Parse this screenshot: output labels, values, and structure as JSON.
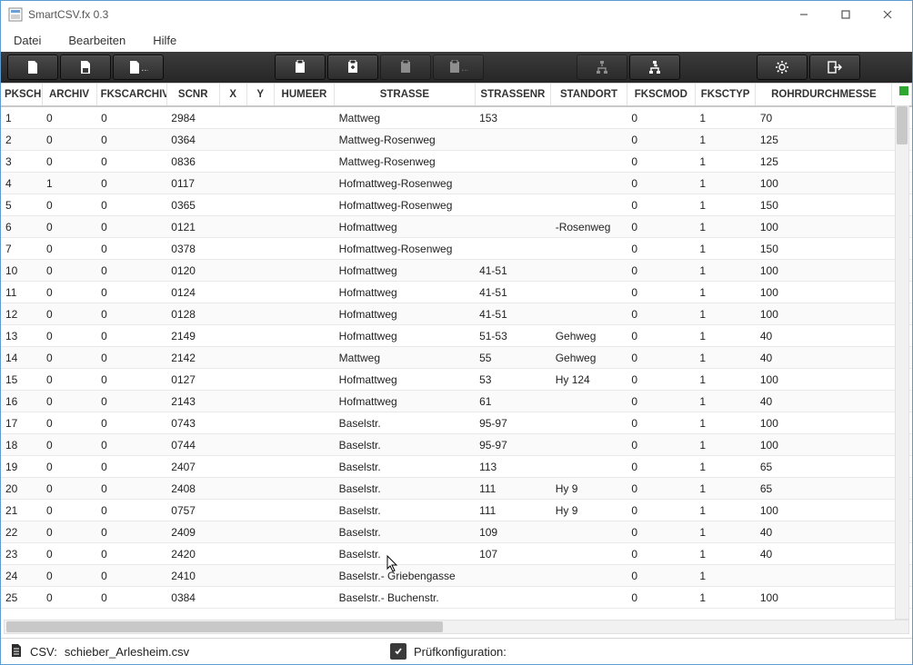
{
  "window": {
    "title": "SmartCSV.fx 0.3"
  },
  "menu": {
    "datei": "Datei",
    "bearbeiten": "Bearbeiten",
    "hilfe": "Hilfe"
  },
  "toolbar": {
    "new_doc": "new-document",
    "save_doc": "save-document",
    "more_doc": "document-menu",
    "clip1": "clipboard-copy",
    "clip2": "clipboard-paste",
    "clip3": "clipboard-col",
    "clip4": "clipboard-row",
    "diag1": "connect-node",
    "diag2": "expand-node",
    "settings": "settings",
    "exit": "exit"
  },
  "columns": [
    "PKSCHIEBER",
    "ARCHIV",
    "FKSCARCHIV",
    "SCNR",
    "X",
    "Y",
    "HUMEER",
    "STRASSE",
    "STRASSENR",
    "STANDORT",
    "FKSCMOD",
    "FKSCTYP",
    "ROHRDURCHMESSE"
  ],
  "rows": [
    {
      "id": "1",
      "archiv": "0",
      "fks": "0",
      "scnr": "2984",
      "x": "",
      "y": "",
      "hu": "",
      "str": "Mattweg",
      "strnr": "153",
      "stand": "",
      "mod": "0",
      "typ": "1",
      "rohr": "70"
    },
    {
      "id": "2",
      "archiv": "0",
      "fks": "0",
      "scnr": "0364",
      "x": "",
      "y": "",
      "hu": "",
      "str": "Mattweg-Rosenweg",
      "strnr": "",
      "stand": "",
      "mod": "0",
      "typ": "1",
      "rohr": "125"
    },
    {
      "id": "3",
      "archiv": "0",
      "fks": "0",
      "scnr": "0836",
      "x": "",
      "y": "",
      "hu": "",
      "str": "Mattweg-Rosenweg",
      "strnr": "",
      "stand": "",
      "mod": "0",
      "typ": "1",
      "rohr": "125"
    },
    {
      "id": "4",
      "archiv": "1",
      "fks": "0",
      "scnr": "0117",
      "x": "",
      "y": "",
      "hu": "",
      "str": "Hofmattweg-Rosenweg",
      "strnr": "",
      "stand": "",
      "mod": "0",
      "typ": "1",
      "rohr": "100"
    },
    {
      "id": "5",
      "archiv": "0",
      "fks": "0",
      "scnr": "0365",
      "x": "",
      "y": "",
      "hu": "",
      "str": "Hofmattweg-Rosenweg",
      "strnr": "",
      "stand": "",
      "mod": "0",
      "typ": "1",
      "rohr": "150"
    },
    {
      "id": "6",
      "archiv": "0",
      "fks": "0",
      "scnr": "0121",
      "x": "",
      "y": "",
      "hu": "",
      "str": "Hofmattweg",
      "strnr": "",
      "stand": "-Rosenweg",
      "mod": "0",
      "typ": "1",
      "rohr": "100"
    },
    {
      "id": "7",
      "archiv": "0",
      "fks": "0",
      "scnr": "0378",
      "x": "",
      "y": "",
      "hu": "",
      "str": "Hofmattweg-Rosenweg",
      "strnr": "",
      "stand": "",
      "mod": "0",
      "typ": "1",
      "rohr": "150"
    },
    {
      "id": "10",
      "archiv": "0",
      "fks": "0",
      "scnr": "0120",
      "x": "",
      "y": "",
      "hu": "",
      "str": "Hofmattweg",
      "strnr": "41-51",
      "stand": "",
      "mod": "0",
      "typ": "1",
      "rohr": "100"
    },
    {
      "id": "11",
      "archiv": "0",
      "fks": "0",
      "scnr": "0124",
      "x": "",
      "y": "",
      "hu": "",
      "str": "Hofmattweg",
      "strnr": "41-51",
      "stand": "",
      "mod": "0",
      "typ": "1",
      "rohr": "100"
    },
    {
      "id": "12",
      "archiv": "0",
      "fks": "0",
      "scnr": "0128",
      "x": "",
      "y": "",
      "hu": "",
      "str": "Hofmattweg",
      "strnr": "41-51",
      "stand": "",
      "mod": "0",
      "typ": "1",
      "rohr": "100"
    },
    {
      "id": "13",
      "archiv": "0",
      "fks": "0",
      "scnr": "2149",
      "x": "",
      "y": "",
      "hu": "",
      "str": "Hofmattweg",
      "strnr": "51-53",
      "stand": "Gehweg",
      "mod": "0",
      "typ": "1",
      "rohr": "40"
    },
    {
      "id": "14",
      "archiv": "0",
      "fks": "0",
      "scnr": "2142",
      "x": "",
      "y": "",
      "hu": "",
      "str": "Mattweg",
      "strnr": "55",
      "stand": "Gehweg",
      "mod": "0",
      "typ": "1",
      "rohr": "40"
    },
    {
      "id": "15",
      "archiv": "0",
      "fks": "0",
      "scnr": "0127",
      "x": "",
      "y": "",
      "hu": "",
      "str": "Hofmattweg",
      "strnr": "53",
      "stand": "Hy 124",
      "mod": "0",
      "typ": "1",
      "rohr": "100"
    },
    {
      "id": "16",
      "archiv": "0",
      "fks": "0",
      "scnr": "2143",
      "x": "",
      "y": "",
      "hu": "",
      "str": "Hofmattweg",
      "strnr": "61",
      "stand": "",
      "mod": "0",
      "typ": "1",
      "rohr": "40"
    },
    {
      "id": "17",
      "archiv": "0",
      "fks": "0",
      "scnr": "0743",
      "x": "",
      "y": "",
      "hu": "",
      "str": "Baselstr.",
      "strnr": "95-97",
      "stand": "",
      "mod": "0",
      "typ": "1",
      "rohr": "100"
    },
    {
      "id": "18",
      "archiv": "0",
      "fks": "0",
      "scnr": "0744",
      "x": "",
      "y": "",
      "hu": "",
      "str": "Baselstr.",
      "strnr": "95-97",
      "stand": "",
      "mod": "0",
      "typ": "1",
      "rohr": "100"
    },
    {
      "id": "19",
      "archiv": "0",
      "fks": "0",
      "scnr": "2407",
      "x": "",
      "y": "",
      "hu": "",
      "str": "Baselstr.",
      "strnr": "113",
      "stand": "",
      "mod": "0",
      "typ": "1",
      "rohr": "65"
    },
    {
      "id": "20",
      "archiv": "0",
      "fks": "0",
      "scnr": "2408",
      "x": "",
      "y": "",
      "hu": "",
      "str": "Baselstr.",
      "strnr": "111",
      "stand": "Hy 9",
      "mod": "0",
      "typ": "1",
      "rohr": "65"
    },
    {
      "id": "21",
      "archiv": "0",
      "fks": "0",
      "scnr": "0757",
      "x": "",
      "y": "",
      "hu": "",
      "str": "Baselstr.",
      "strnr": "111",
      "stand": "Hy 9",
      "mod": "0",
      "typ": "1",
      "rohr": "100"
    },
    {
      "id": "22",
      "archiv": "0",
      "fks": "0",
      "scnr": "2409",
      "x": "",
      "y": "",
      "hu": "",
      "str": "Baselstr.",
      "strnr": "109",
      "stand": "",
      "mod": "0",
      "typ": "1",
      "rohr": "40"
    },
    {
      "id": "23",
      "archiv": "0",
      "fks": "0",
      "scnr": "2420",
      "x": "",
      "y": "",
      "hu": "",
      "str": "Baselstr.",
      "strnr": "107",
      "stand": "",
      "mod": "0",
      "typ": "1",
      "rohr": "40"
    },
    {
      "id": "24",
      "archiv": "0",
      "fks": "0",
      "scnr": "2410",
      "x": "",
      "y": "",
      "hu": "",
      "str": "Baselstr.- Griebengasse",
      "strnr": "",
      "stand": "",
      "mod": "0",
      "typ": "1",
      "rohr": ""
    },
    {
      "id": "25",
      "archiv": "0",
      "fks": "0",
      "scnr": "0384",
      "x": "",
      "y": "",
      "hu": "",
      "str": "Baselstr.- Buchenstr.",
      "strnr": "",
      "stand": "",
      "mod": "0",
      "typ": "1",
      "rohr": "100"
    }
  ],
  "status": {
    "csv_label": "CSV:",
    "csv_file": "schieber_Arlesheim.csv",
    "check_label": "Prüfkonfiguration:"
  }
}
